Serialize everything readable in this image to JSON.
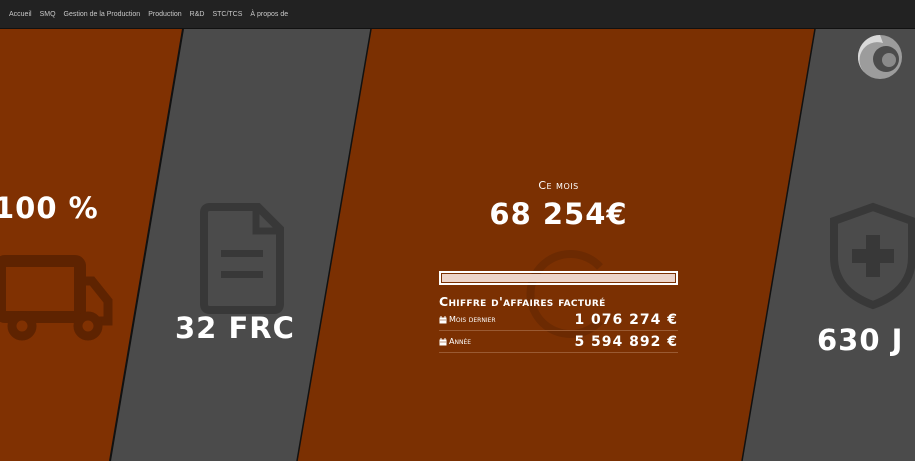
{
  "nav": {
    "items": [
      {
        "label": "Accueil"
      },
      {
        "label": "SMQ"
      },
      {
        "label": "Gestion de la Production"
      },
      {
        "label": "Production"
      },
      {
        "label": "R&D"
      },
      {
        "label": "STC/TCS"
      },
      {
        "label": "À propos de"
      }
    ]
  },
  "panels": {
    "delivery": {
      "value": "100 %",
      "icon": "truck-icon"
    },
    "documents": {
      "value": "32 FRC",
      "icon": "file-icon"
    },
    "safety": {
      "value": "630 J",
      "icon": "shield-plus-icon"
    }
  },
  "revenue": {
    "title": "Ce mois",
    "value": "68 254€",
    "progress": 1.0,
    "subtitle": "Chiffre d'affaires facturé",
    "rows": [
      {
        "label": "Mois dernier",
        "value": "1 076 274 €",
        "icon": "calendar-icon"
      },
      {
        "label": "Année",
        "value": "5 594 892 €",
        "icon": "calendar-icon"
      }
    ]
  },
  "colors": {
    "brown": "#803102",
    "gray": "#4a4a4a",
    "navbar": "#222222"
  },
  "logo": {
    "icon": "company-logo-icon"
  }
}
